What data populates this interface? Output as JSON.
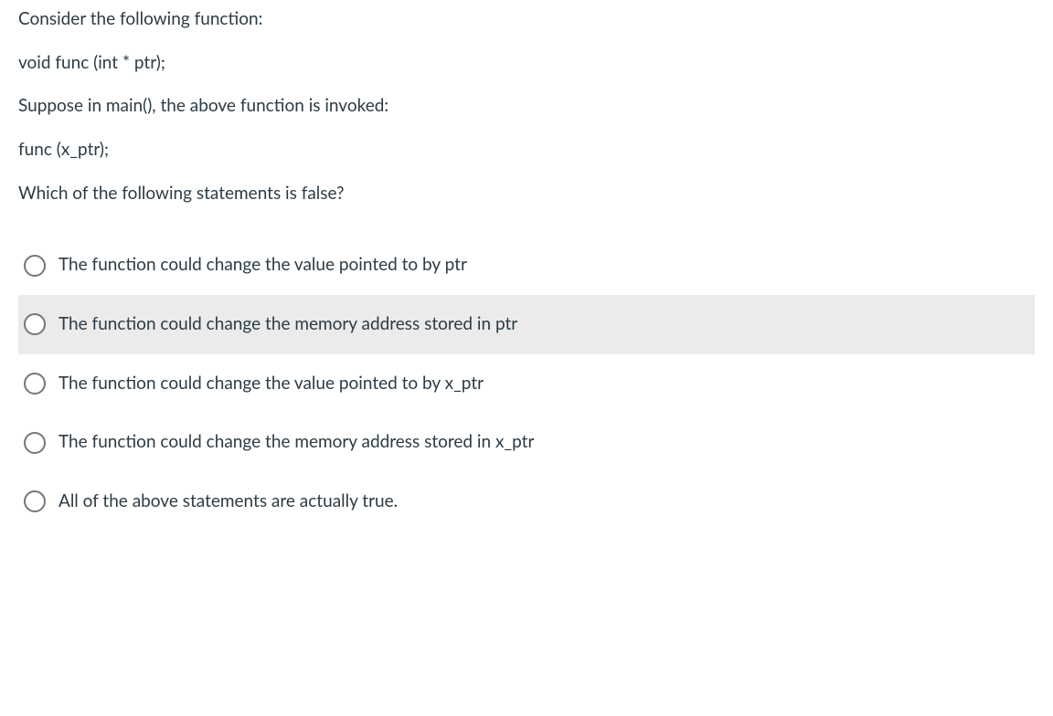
{
  "question": {
    "lines": [
      "Consider the following function:",
      "void func (int * ptr);",
      "Suppose in main(), the above function is invoked:",
      "func (x_ptr);",
      "Which of the following statements is false?"
    ]
  },
  "answers": [
    {
      "label": "The function could change the value pointed to by ptr",
      "hover": false
    },
    {
      "label": "The function could change the memory address stored in ptr",
      "hover": true
    },
    {
      "label": "The function could change the value pointed to by x_ptr",
      "hover": false
    },
    {
      "label": "The function could change the memory address stored in x_ptr",
      "hover": false
    },
    {
      "label": "All of the above statements are actually true.",
      "hover": false
    }
  ]
}
